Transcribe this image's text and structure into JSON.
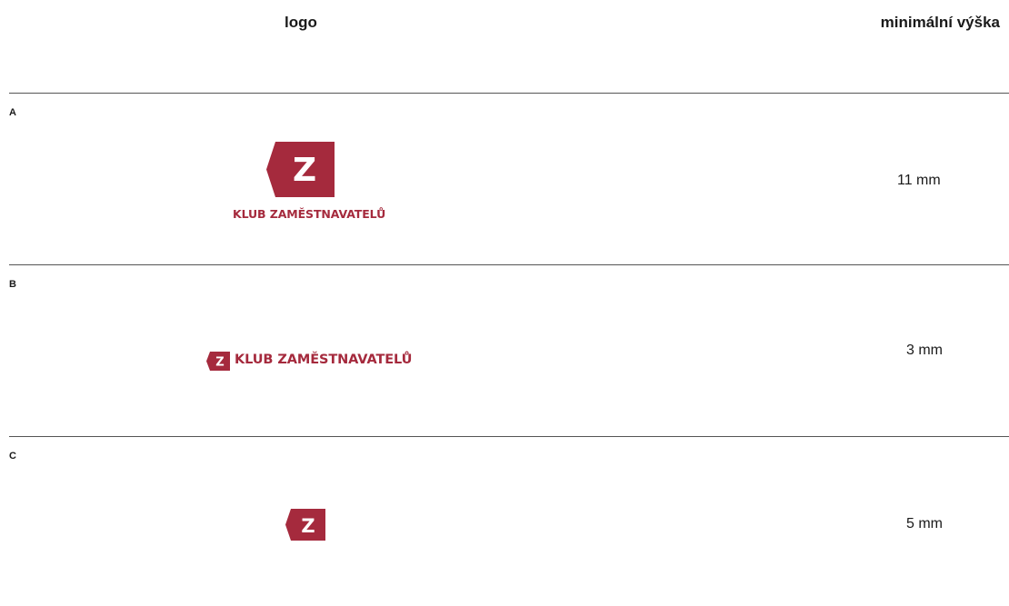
{
  "header": {
    "logo_col": "logo",
    "height_col": "minimální výška"
  },
  "brand": {
    "name": "KLUB ZAMĚSTNAVATELŮ",
    "mark_letter": "Z",
    "color": "#A52A3D",
    "text_color": "#ffffff"
  },
  "rows": [
    {
      "label": "A",
      "variant": "mark-above-wordmark",
      "min_height": "11 mm"
    },
    {
      "label": "B",
      "variant": "mark-beside-wordmark",
      "min_height": "3 mm"
    },
    {
      "label": "C",
      "variant": "mark-only",
      "min_height": "5 mm"
    }
  ]
}
